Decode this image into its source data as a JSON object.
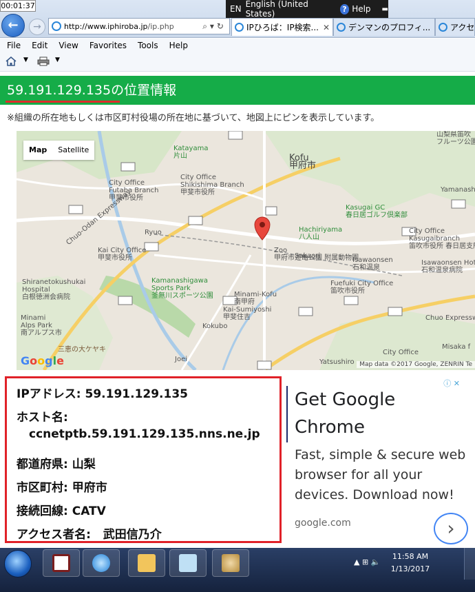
{
  "timer": "00:01:37",
  "langbar": {
    "lang_code": "EN",
    "lang_name": "English (United States)",
    "help": "Help"
  },
  "browser": {
    "url_host": "http://www.iphiroba.jp",
    "url_path": "/ip.php",
    "tabs": [
      {
        "label": "IPひろば：IP検索..."
      },
      {
        "label": "デンマンのプロフィ..."
      },
      {
        "label": "アクセ"
      }
    ]
  },
  "menu": [
    "File",
    "Edit",
    "View",
    "Favorites",
    "Tools",
    "Help"
  ],
  "page": {
    "heading_ip": "59.191.129.135",
    "heading_suffix": "の位置情報",
    "note": "※組織の所在地もしくは市区町村役場の所在地に基づいて、地図上にピンを表示しています。"
  },
  "map": {
    "tab_map": "Map",
    "tab_satellite": "Satellite",
    "labels": {
      "katayama": "Katayama",
      "katayama_jp": "片山",
      "kofu": "Kofu",
      "kofu_jp": "甲府市",
      "city_office": "City Office",
      "futaba": "Futaba Branch",
      "kofu_office_jp": "甲斐市役所",
      "shikishima": "Shikishima Branch",
      "kofu_shiyakusho_jp": "甲斐市役所",
      "kasugai_gc": "Kasugai GC",
      "kasugai_gc_jp": "春日居ゴルフ倶楽部",
      "hachiriyama": "Hachiriyama",
      "hachiriyama_jp": "八人山",
      "kasugai_branch": "Kasugaibranch",
      "kasugai_branch_jp": "笛吹市役所 春日居支所",
      "kai": "Kai City Office",
      "kai_jp": "甲斐市役所",
      "sakaori": "Sakaori",
      "zoo": "Zoo",
      "zoo_jp": "甲府市遊亀公園 附属動物園",
      "isawa": "Isawaonsen",
      "isawa_jp": "石和温泉",
      "isawa_ho": "Isawaonsen Hot",
      "isawa_ho_jp": "石和温泉病院",
      "fuefuki": "Fuefuki City Office",
      "fuefuki_jp": "笛吹市役所",
      "shiranetokushukai": "Shiranetokushukai",
      "hospital": "Hospital",
      "shirane_jp": "白根徳洲会病院",
      "kamanashigawa": "Kamanashigawa",
      "sports_park": "Sports Park",
      "kamanashi_jp": "釜無川スポーツ公園",
      "minami_kofu": "Minami-Kofu",
      "minami_kofu_jp": "南甲府",
      "kai_sumiyoshi": "Kai-Sumiyoshi",
      "kai_sumiyoshi_jp": "甲斐住吉",
      "kokubo": "Kokubo",
      "minami_alps": "Minami",
      "minami_alps2": "Alps Park",
      "minami_alps_jp": "南アルプス市",
      "joei": "Joei",
      "sanbon": "三恵の大ケヤキ",
      "yatsushiro": "Yatsushiro",
      "city_office2": "City Office",
      "misaka": "Misaka f",
      "chuo_exp": "Chuo Expressway",
      "chuo_exp2": "Chuo Expressway",
      "chuo_odan": "Chuo-Odan Expressway",
      "ryuo": "Ryuo",
      "yamanashi": "Yamanashi",
      "yamanashi_jp": "山梨県笛吹",
      "fruit": "フルーツ公園"
    },
    "logo": "Google",
    "copyright": "Map data ©2017 Google, ZENRIN   Te"
  },
  "info": {
    "ip_label": "IPアドレス: ",
    "ip_value": "59.191.129.135",
    "host_label": "ホスト名:",
    "host_value": "ccnetptb.59.191.129.135.nns.ne.jp",
    "pref_label": "都道府県: ",
    "pref_value": "山梨",
    "city_label": "市区町村: ",
    "city_value": "甲府市",
    "line_label": "接続回線: ",
    "line_value": "CATV",
    "accessor_label": "アクセス者名:   ",
    "accessor_value": "武田信乃介"
  },
  "ad": {
    "title": "Get Google Chrome",
    "body": "Fast, simple & secure web browser for all your devices. Download now!",
    "domain": "google.com",
    "next": "›",
    "badges": "ⓘ ✕"
  },
  "taskbar": {
    "time": "11:58 AM",
    "date": "1/13/2017"
  }
}
